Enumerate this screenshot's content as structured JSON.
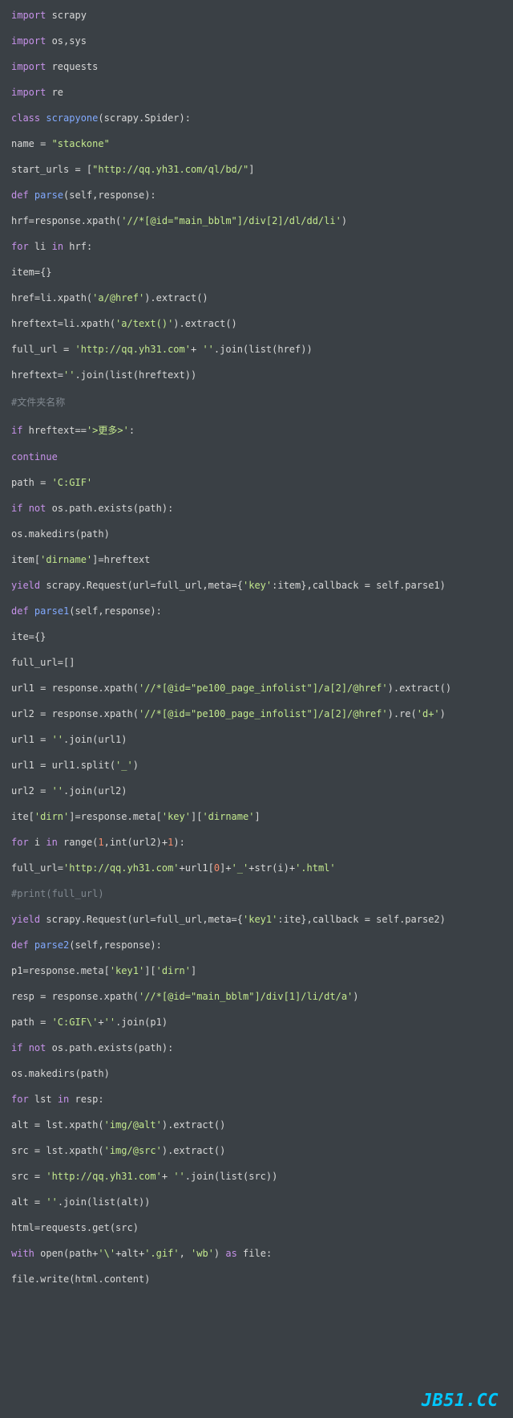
{
  "lines": [
    {
      "html": "<span class='kw'>import</span> scrapy"
    },
    {
      "html": "<span class='kw'>import</span> os,sys"
    },
    {
      "html": "<span class='kw'>import</span> requests"
    },
    {
      "html": "<span class='kw'>import</span> re"
    },
    {
      "html": "<span class='kw'>class</span> <span class='fn'>scrapyone</span>(scrapy.Spider):"
    },
    {
      "html": "name = <span class='str'>\"stackone\"</span>"
    },
    {
      "html": "start_urls = [<span class='str'>\"http://qq.yh31.com/ql/bd/\"</span>]"
    },
    {
      "html": "<span class='kw'>def</span> <span class='fn'>parse</span>(self,response):"
    },
    {
      "html": "hrf=response.xpath(<span class='str'>'//*[@id=\"main_bblm\"]/div[2]/dl/dd/li'</span>)"
    },
    {
      "html": "<span class='kw'>for</span> li <span class='kw'>in</span> hrf:"
    },
    {
      "html": "item={}"
    },
    {
      "html": "href=li.xpath(<span class='str'>'a/@href'</span>).extract()"
    },
    {
      "html": "hreftext=li.xpath(<span class='str'>'a/text()'</span>).extract()"
    },
    {
      "html": "full_url = <span class='str'>'http://qq.yh31.com'</span>+ <span class='str'>''</span>.join(list(href))"
    },
    {
      "html": "hreftext=<span class='str'>''</span>.join(list(hreftext))"
    },
    {
      "html": "<span class='comment'>#文件夹名称</span>"
    },
    {
      "html": "<span class='kw'>if</span> hreftext==<span class='str'>'&gt;更多&gt;'</span>:"
    },
    {
      "html": "<span class='kw'>continue</span>"
    },
    {
      "html": "path = <span class='str'>'C:GIF'</span>"
    },
    {
      "html": "<span class='kw'>if</span> <span class='kw'>not</span> os.path.exists(path):"
    },
    {
      "html": "os.makedirs(path)"
    },
    {
      "html": "item[<span class='str'>'dirname'</span>]=hreftext"
    },
    {
      "html": "<span class='kw'>yield</span> scrapy.Request(url=full_url,meta={<span class='str'>'key'</span>:item},callback = self.parse1)"
    },
    {
      "html": "<span class='kw'>def</span> <span class='fn'>parse1</span>(self,response):"
    },
    {
      "html": "ite={}"
    },
    {
      "html": "full_url=[]"
    },
    {
      "html": "url1 = response.xpath(<span class='str'>'//*[@id=\"pe100_page_infolist\"]/a[2]/@href'</span>).extract()"
    },
    {
      "html": "url2 = response.xpath(<span class='str'>'//*[@id=\"pe100_page_infolist\"]/a[2]/@href'</span>).re(<span class='str'>'d+'</span>)"
    },
    {
      "html": "url1 = <span class='str'>''</span>.join(url1)"
    },
    {
      "html": "url1 = url1.split(<span class='str'>'_'</span>)"
    },
    {
      "html": "url2 = <span class='str'>''</span>.join(url2)"
    },
    {
      "html": "ite[<span class='str'>'dirn'</span>]=response.meta[<span class='str'>'key'</span>][<span class='str'>'dirname'</span>]"
    },
    {
      "html": "<span class='kw'>for</span> i <span class='kw'>in</span> range(<span class='num'>1</span>,int(url2)+<span class='num'>1</span>):"
    },
    {
      "html": "full_url=<span class='str'>'http://qq.yh31.com'</span>+url1[<span class='num'>0</span>]+<span class='str'>'_'</span>+str(i)+<span class='str'>'.html'</span>"
    },
    {
      "html": "<span class='comment'>#print(full_url)</span>"
    },
    {
      "html": "<span class='kw'>yield</span> scrapy.Request(url=full_url,meta={<span class='str'>'key1'</span>:ite},callback = self.parse2)"
    },
    {
      "html": "<span class='kw'>def</span> <span class='fn'>parse2</span>(self,response):"
    },
    {
      "html": "p1=response.meta[<span class='str'>'key1'</span>][<span class='str'>'dirn'</span>]"
    },
    {
      "html": "resp = response.xpath(<span class='str'>'//*[@id=\"main_bblm\"]/div[1]/li/dt/a'</span>)"
    },
    {
      "html": "path = <span class='str'>'C:GIF\\'</span>+<span class='str'>''</span>.join(p1)"
    },
    {
      "html": "<span class='kw'>if</span> <span class='kw'>not</span> os.path.exists(path):"
    },
    {
      "html": "os.makedirs(path)"
    },
    {
      "html": "<span class='kw'>for</span> lst <span class='kw'>in</span> resp:"
    },
    {
      "html": "alt = lst.xpath(<span class='str'>'img/@alt'</span>).extract()"
    },
    {
      "html": "src = lst.xpath(<span class='str'>'img/@src'</span>).extract()"
    },
    {
      "html": "src = <span class='str'>'http://qq.yh31.com'</span>+ <span class='str'>''</span>.join(list(src))"
    },
    {
      "html": "alt = <span class='str'>''</span>.join(list(alt))"
    },
    {
      "html": "html=requests.get(src)"
    },
    {
      "html": "<span class='kw'>with</span> open(path+<span class='str'>'\\'</span>+alt+<span class='str'>'.gif'</span>, <span class='str'>'wb'</span>) <span class='kw'>as</span> file:"
    },
    {
      "html": "file.write(html.content)"
    }
  ],
  "watermark": "JB51.CC"
}
